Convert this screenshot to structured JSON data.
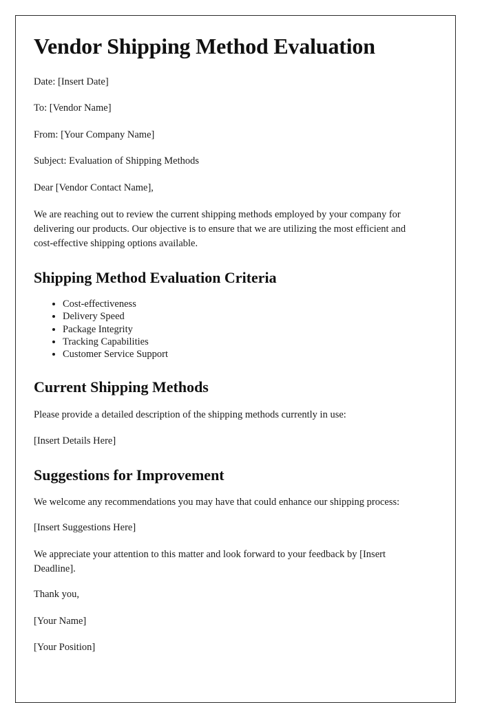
{
  "document": {
    "title": "Vendor Shipping Method Evaluation",
    "meta": {
      "date": "Date: [Insert Date]",
      "to": "To: [Vendor Name]",
      "from": "From: [Your Company Name]",
      "subject": "Subject: Evaluation of Shipping Methods"
    },
    "salutation": "Dear [Vendor Contact Name],",
    "intro": "We are reaching out to review the current shipping methods employed by your company for delivering our products. Our objective is to ensure that we are utilizing the most efficient and cost-effective shipping options available.",
    "sections": {
      "criteria": {
        "heading": "Shipping Method Evaluation Criteria",
        "items": [
          "Cost-effectiveness",
          "Delivery Speed",
          "Package Integrity",
          "Tracking Capabilities",
          "Customer Service Support"
        ]
      },
      "current_methods": {
        "heading": "Current Shipping Methods",
        "prompt": "Please provide a detailed description of the shipping methods currently in use:",
        "placeholder": "[Insert Details Here]"
      },
      "suggestions": {
        "heading": "Suggestions for Improvement",
        "prompt": "We welcome any recommendations you may have that could enhance our shipping process:",
        "placeholder": "[Insert Suggestions Here]"
      }
    },
    "closing": {
      "deadline_request": "We appreciate your attention to this matter and look forward to your feedback by [Insert Deadline].",
      "thanks": "Thank you,",
      "signature_name": "[Your Name]",
      "signature_position": "[Your Position]"
    }
  },
  "colors": {
    "page_background": "#ffffff",
    "text": "#1a1a1a",
    "heading": "#111111",
    "page_border": "#2b2b2b"
  }
}
